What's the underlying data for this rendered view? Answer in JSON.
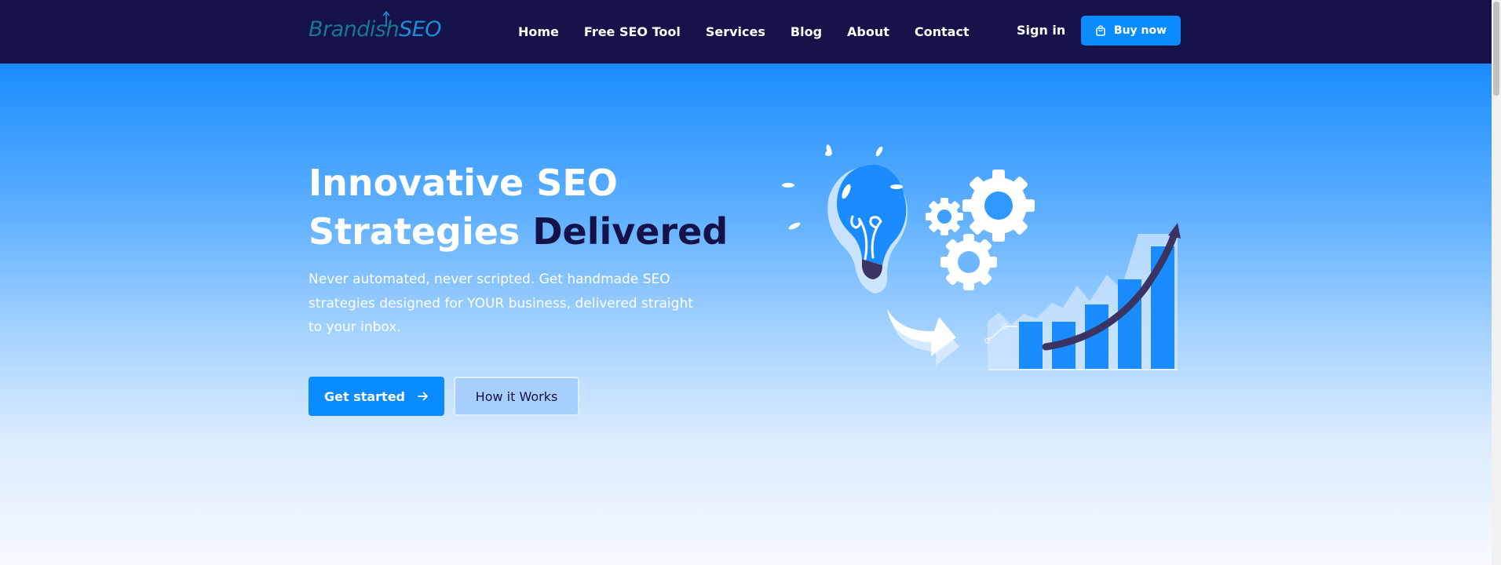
{
  "brand": {
    "name_part1": "Brandish",
    "name_part2": "SEO"
  },
  "nav": {
    "links": [
      "Home",
      "Free SEO Tool",
      "Services",
      "Blog",
      "About",
      "Contact"
    ],
    "signin": "Sign in",
    "buy": "Buy now"
  },
  "hero": {
    "headline_line1": "Innovative SEO",
    "headline_line2_a": "Strategies",
    "headline_line2_b": "Delivered",
    "subtext": "Never automated, never scripted. Get handmade SEO strategies designed for YOUR business, delivered straight to your inbox.",
    "cta_primary": "Get started",
    "cta_secondary": "How it Works"
  },
  "colors": {
    "navbar": "#16134a",
    "accent": "#0a8bff",
    "dark_text": "#15124a"
  },
  "icons": {
    "buy": "shopping-bag-icon",
    "cta": "arrow-right-icon"
  }
}
